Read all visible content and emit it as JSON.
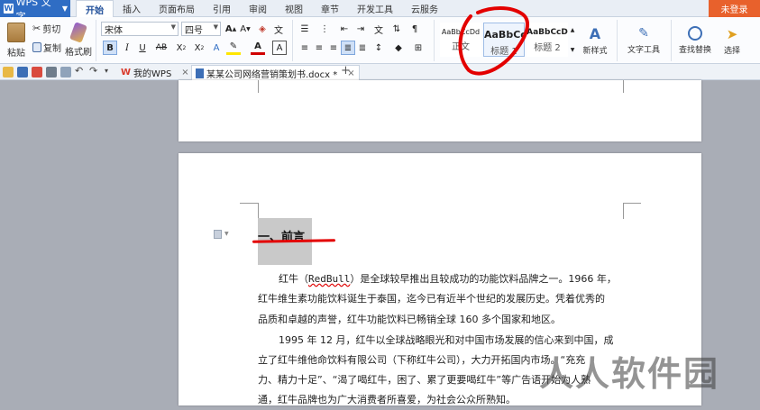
{
  "app": {
    "name": "WPS 文字",
    "login": "未登录"
  },
  "menu_tabs": [
    "开始",
    "插入",
    "页面布局",
    "引用",
    "审阅",
    "视图",
    "章节",
    "开发工具",
    "云服务"
  ],
  "ribbon": {
    "paste": "粘贴",
    "cut": "剪切",
    "copy": "复制",
    "format_painter": "格式刷",
    "font_name": "宋体",
    "font_size": "四号",
    "styles": [
      {
        "preview": "AaBbCcDd",
        "name": "正文"
      },
      {
        "preview": "AaBbCc",
        "name": "标题 1"
      },
      {
        "preview": "AaBbCcD",
        "name": "标题 2"
      }
    ],
    "new_style": "新样式",
    "text_tools": "文字工具",
    "find_replace": "查找替换",
    "select": "选择"
  },
  "doc_tabs": [
    {
      "label": "我的WPS",
      "active": false
    },
    {
      "label": "某某公司网络营销策划书.docx *",
      "active": true
    }
  ],
  "document": {
    "heading": "一、前言",
    "paragraphs": [
      "红牛（RedBull）是全球较早推出且较成功的功能饮料品牌之一。1966 年，",
      "红牛维生素功能饮料诞生于泰国，迄今已有近半个世纪的发展历史。凭着优秀的",
      "品质和卓越的声誉，红牛功能饮料已畅销全球 160 多个国家和地区。",
      "1995 年 12 月，红牛以全球战略眼光和对中国市场发展的信心来到中国，成",
      "立了红牛维他命饮料有限公司（下称红牛公司），大力开拓国内市场。“充充",
      "力、精力十足”、“渴了喝红牛，困了、累了更要喝红牛”等广告语开始为人熟",
      "通，红牛品牌也为广大消费者所喜爱，为社会公众所熟知。"
    ]
  },
  "watermark": "人人软件园",
  "colors": {
    "accent": "#2f6dc4",
    "login": "#e8612c",
    "annotation": "#e30000",
    "canvas": "#a9adb6"
  }
}
